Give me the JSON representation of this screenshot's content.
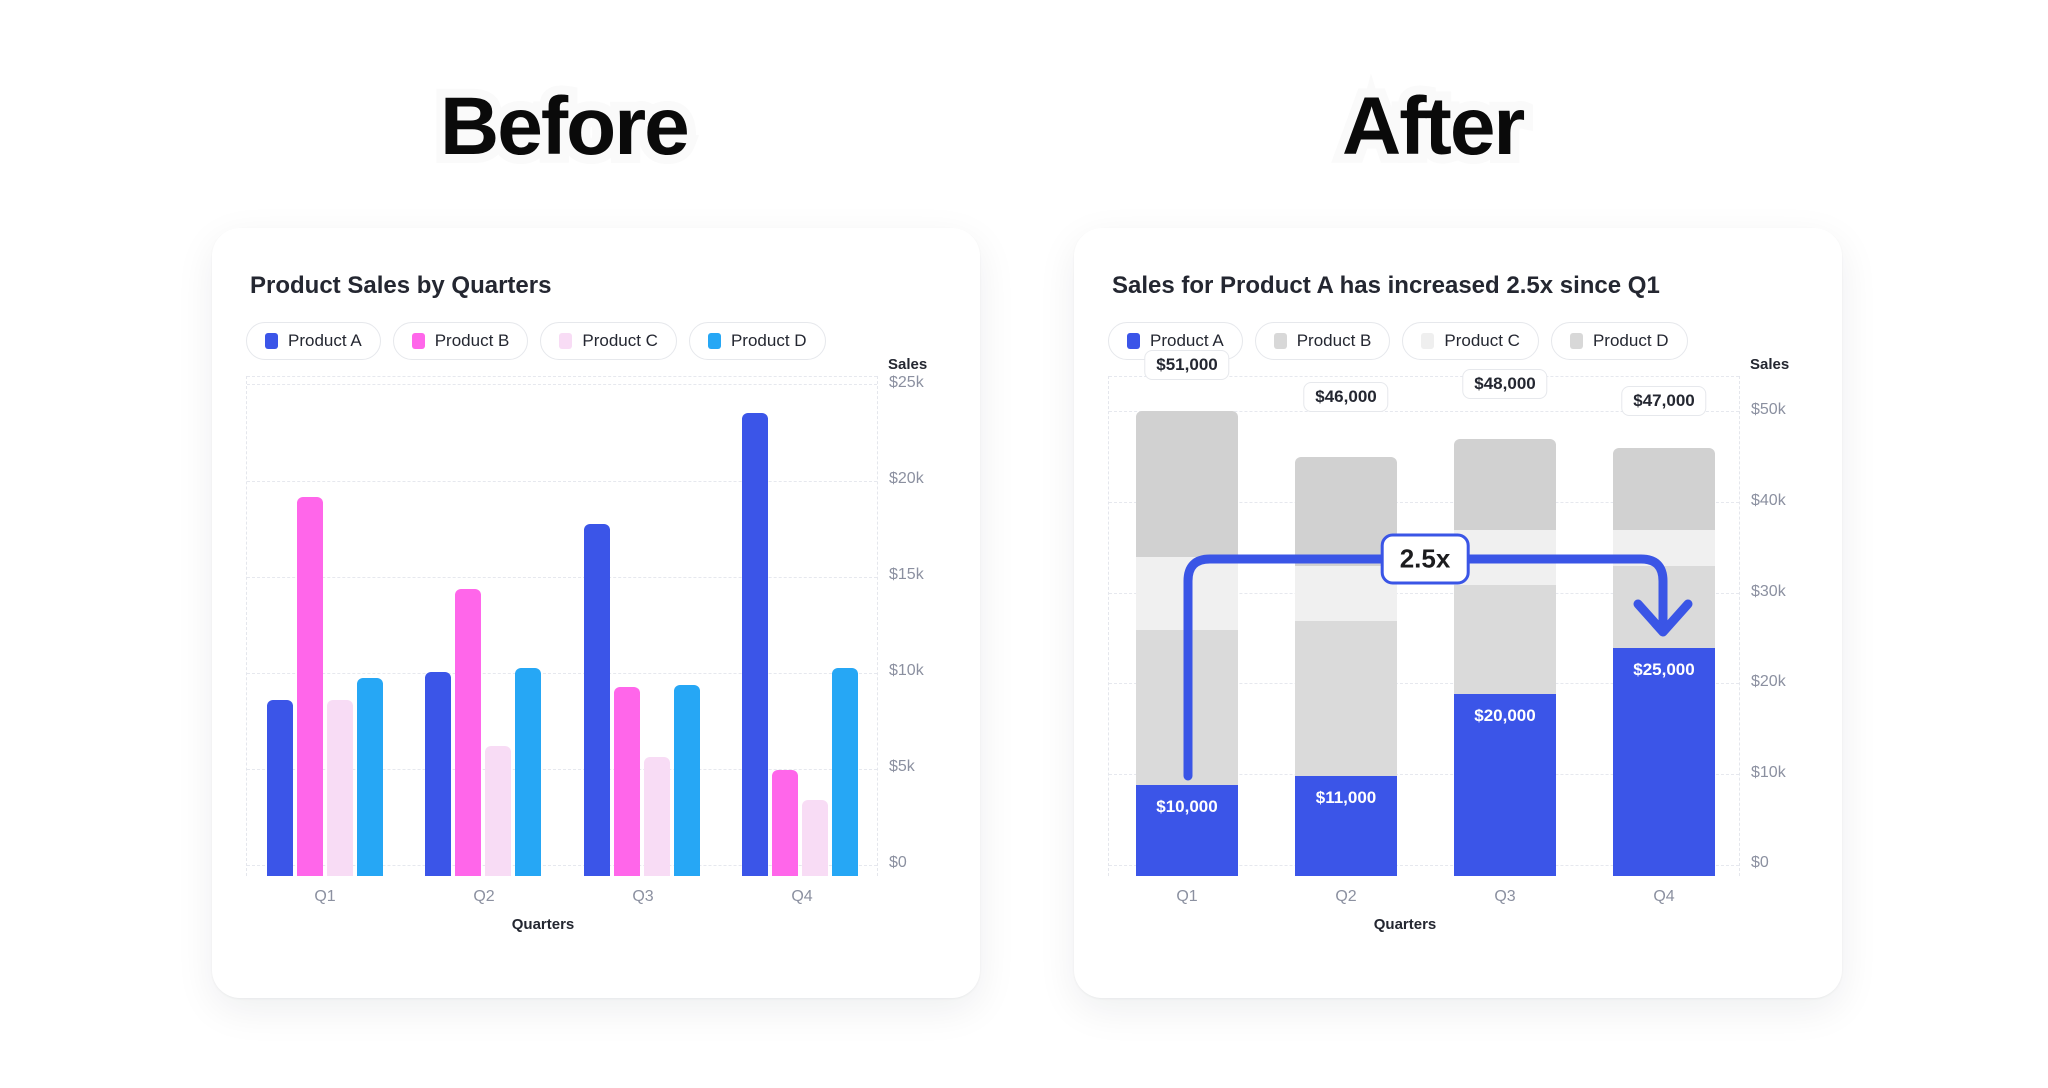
{
  "headings": {
    "before": "Before",
    "after": "After"
  },
  "colors": {
    "product_a": "#3b55e8",
    "product_b": "#ff66ea",
    "product_c": "#f8dcf5",
    "product_d": "#26a7f5",
    "muted_dark": "#d1d1d1",
    "muted_mid": "#dadada",
    "muted_light": "#f0f0f0",
    "accent": "#3a55e6",
    "axis_text": "#8b90a0",
    "title_text": "#242731"
  },
  "before": {
    "title": "Product Sales by Quarters",
    "legend": [
      {
        "label": "Product A",
        "color": "#3b55e8"
      },
      {
        "label": "Product B",
        "color": "#ff66ea"
      },
      {
        "label": "Product C",
        "color": "#f8dcf5"
      },
      {
        "label": "Product D",
        "color": "#26a7f5"
      }
    ],
    "y_axis_title": "Sales",
    "x_axis_title": "Quarters",
    "y_ticks": [
      "$25k",
      "$20k",
      "$15k",
      "$10k",
      "$5k",
      "$0"
    ],
    "x_ticks": [
      "Q1",
      "Q2",
      "Q3",
      "Q4"
    ]
  },
  "after": {
    "title": "Sales for Product A has increased 2.5x since Q1",
    "legend": [
      {
        "label": "Product A",
        "color": "#3b55e8"
      },
      {
        "label": "Product B",
        "color": "#d8d8d8"
      },
      {
        "label": "Product C",
        "color": "#efefef"
      },
      {
        "label": "Product D",
        "color": "#d8d8d8"
      }
    ],
    "y_axis_title": "Sales",
    "x_axis_title": "Quarters",
    "y_ticks": [
      "$50k",
      "$40k",
      "$30k",
      "$20k",
      "$10k",
      "$0"
    ],
    "x_ticks": [
      "Q1",
      "Q2",
      "Q3",
      "Q4"
    ],
    "totals": [
      "$51,000",
      "$46,000",
      "$48,000",
      "$47,000"
    ],
    "a_labels": [
      "$10,000",
      "$11,000",
      "$20,000",
      "$25,000"
    ],
    "annotation": "2.5x"
  },
  "chart_data": [
    {
      "type": "bar",
      "id": "before",
      "title": "Product Sales by Quarters",
      "xlabel": "Quarters",
      "ylabel": "Sales",
      "ylim": [
        0,
        27000
      ],
      "ytick_values": [
        0,
        5000,
        10000,
        15000,
        20000,
        25000
      ],
      "ytick_labels": [
        "$0",
        "$5k",
        "$10k",
        "$15k",
        "$20k",
        "$25k"
      ],
      "categories": [
        "Q1",
        "Q2",
        "Q3",
        "Q4"
      ],
      "grid": true,
      "legend_position": "top-left",
      "grouping": "grouped",
      "series": [
        {
          "name": "Product A",
          "color": "#3b55e8",
          "values": [
            9500,
            11000,
            19000,
            25000
          ]
        },
        {
          "name": "Product B",
          "color": "#ff66ea",
          "values": [
            20500,
            15500,
            10200,
            5700
          ]
        },
        {
          "name": "Product C",
          "color": "#f8dcf5",
          "values": [
            9500,
            7000,
            6400,
            4100
          ]
        },
        {
          "name": "Product D",
          "color": "#26a7f5",
          "values": [
            10700,
            11200,
            10300,
            11200
          ]
        }
      ]
    },
    {
      "type": "bar",
      "id": "after",
      "title": "Sales for Product A has increased 2.5x since Q1",
      "xlabel": "Quarters",
      "ylabel": "Sales",
      "ylim": [
        0,
        55000
      ],
      "ytick_values": [
        0,
        10000,
        20000,
        30000,
        40000,
        50000
      ],
      "ytick_labels": [
        "$0",
        "$10k",
        "$20k",
        "$30k",
        "$40k",
        "$50k"
      ],
      "categories": [
        "Q1",
        "Q2",
        "Q3",
        "Q4"
      ],
      "grid": true,
      "legend_position": "top-left",
      "grouping": "stacked",
      "totals": [
        51000,
        46000,
        48000,
        47000
      ],
      "series": [
        {
          "name": "Product A",
          "color": "#3b55e8",
          "values": [
            10000,
            11000,
            20000,
            25000
          ],
          "highlighted": true
        },
        {
          "name": "Product B",
          "color": "#d8d8d8",
          "values": [
            17000,
            17000,
            12000,
            9000
          ]
        },
        {
          "name": "Product C",
          "color": "#efefef",
          "values": [
            8000,
            6000,
            6000,
            4000
          ]
        },
        {
          "name": "Product D",
          "color": "#d1d1d1",
          "values": [
            16000,
            12000,
            10000,
            9000
          ]
        }
      ],
      "annotations": [
        {
          "text": "2.5x",
          "from": "Q1",
          "to": "Q4",
          "type": "curved-arrow"
        }
      ]
    }
  ]
}
